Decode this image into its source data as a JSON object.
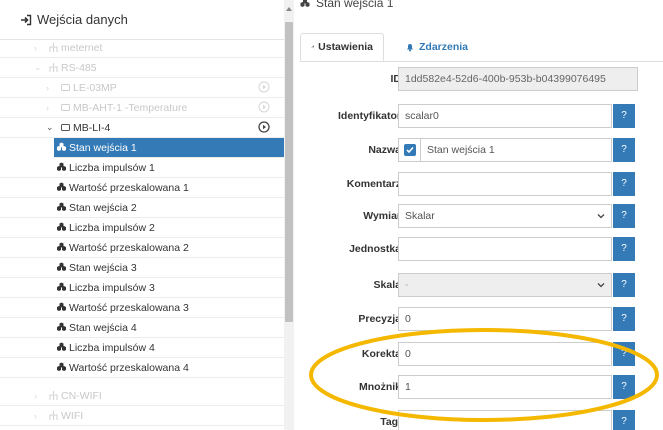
{
  "tree": {
    "header": "Wejścia danych",
    "items": [
      {
        "label": "meternet",
        "depth": 1,
        "faded": true
      },
      {
        "label": "RS-485",
        "depth": 1,
        "faded": true,
        "expanded": true
      },
      {
        "label": "LE-03MP",
        "depth": 2,
        "faded": true
      },
      {
        "label": "MB-AHT-1 -Temperature",
        "depth": 2,
        "faded": true
      },
      {
        "label": "MB-LI-4",
        "depth": 2,
        "faded": false,
        "expanded": true
      },
      {
        "label": "CN-WIFI",
        "depth": 1,
        "faded": true
      },
      {
        "label": "WIFI",
        "depth": 1,
        "faded": true
      }
    ],
    "children": [
      {
        "label": "Stan wejścia 1",
        "selected": true
      },
      {
        "label": "Liczba impulsów 1"
      },
      {
        "label": "Wartość przeskalowana 1"
      },
      {
        "label": "Stan wejścia 2"
      },
      {
        "label": "Liczba impulsów 2"
      },
      {
        "label": "Wartość przeskalowana 2"
      },
      {
        "label": "Stan wejścia 3"
      },
      {
        "label": "Liczba impulsów 3"
      },
      {
        "label": "Wartość przeskalowana 3"
      },
      {
        "label": "Stan wejścia 4"
      },
      {
        "label": "Liczba impulsów 4"
      },
      {
        "label": "Wartość przeskalowana 4"
      }
    ]
  },
  "detail": {
    "title": "Stan wejścia 1",
    "tabs": [
      {
        "label": "Ustawienia",
        "icon": "wrench-icon",
        "active": true
      },
      {
        "label": "Zdarzenia",
        "icon": "bell-icon",
        "active": false
      }
    ],
    "help_label": "?",
    "fields": {
      "id": {
        "label": "ID",
        "value": "1dd582e4-52d6-400b-953b-b04399076495"
      },
      "identifier": {
        "label": "Identyfikator",
        "value": "scalar0"
      },
      "name": {
        "label": "Nazwa",
        "value": "Stan wejścia 1",
        "checked": true
      },
      "comment": {
        "label": "Komentarz",
        "value": ""
      },
      "dimension": {
        "label": "Wymiar",
        "value": "Skalar"
      },
      "unit": {
        "label": "Jednostka",
        "value": ""
      },
      "scale": {
        "label": "Skala",
        "value": "-"
      },
      "precision": {
        "label": "Precyzja",
        "value": "0"
      },
      "correction": {
        "label": "Korekta",
        "value": "0"
      },
      "multiplier": {
        "label": "Mnożnik",
        "value": "1"
      },
      "tags": {
        "label": "Tagi",
        "value": ""
      }
    }
  },
  "colors": {
    "accent": "#337ab7",
    "highlight": "#f5b800"
  }
}
